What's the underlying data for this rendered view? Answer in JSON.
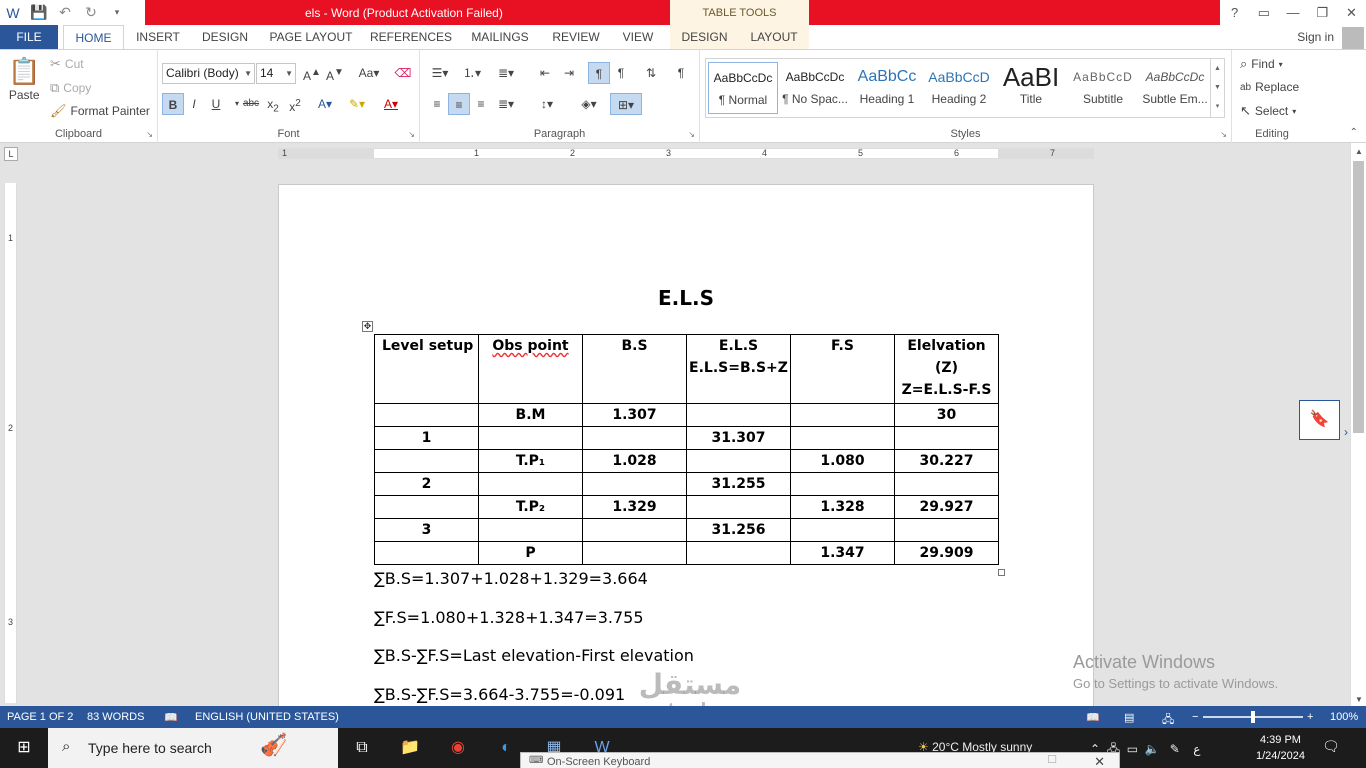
{
  "titlebar": {
    "doc_title": "els -  Word (Product Activation Failed)",
    "table_tools": "TABLE TOOLS",
    "help": "?",
    "restore": "▭",
    "minimize": "—",
    "maximize": "❐",
    "close": "✕"
  },
  "tabs": {
    "file": "FILE",
    "home": "HOME",
    "insert": "INSERT",
    "design": "DESIGN",
    "page_layout": "PAGE LAYOUT",
    "references": "REFERENCES",
    "mailings": "MAILINGS",
    "review": "REVIEW",
    "view": "VIEW",
    "table_design": "DESIGN",
    "table_layout": "LAYOUT",
    "sign_in": "Sign in"
  },
  "clipboard": {
    "paste": "Paste",
    "cut": "Cut",
    "copy": "Copy",
    "format_painter": "Format Painter",
    "label": "Clipboard"
  },
  "font": {
    "font_name": "Calibri (Body)",
    "font_size": "14",
    "label": "Font"
  },
  "paragraph": {
    "label": "Paragraph"
  },
  "styles": {
    "label": "Styles",
    "items": [
      {
        "preview": "AaBbCcDc",
        "name": "¶ Normal"
      },
      {
        "preview": "AaBbCcDc",
        "name": "¶ No Spac..."
      },
      {
        "preview": "AaBbCc",
        "name": "Heading 1"
      },
      {
        "preview": "AaBbCcD",
        "name": "Heading 2"
      },
      {
        "preview": "AaBI",
        "name": "Title"
      },
      {
        "preview": "AaBbCcD",
        "name": "Subtitle"
      },
      {
        "preview": "AaBbCcDc",
        "name": "Subtle Em..."
      }
    ]
  },
  "editing": {
    "find": "Find",
    "replace": "Replace",
    "select": "Select",
    "label": "Editing"
  },
  "ruler": {
    "h": [
      "1",
      "1",
      "2",
      "3",
      "4",
      "5",
      "6",
      "7"
    ],
    "v": [
      "1",
      "2",
      "3"
    ]
  },
  "document": {
    "heading": "E.L.S",
    "table": {
      "header": [
        "Level setup",
        "Obs point",
        "B.S",
        "E.L.S\nE.L.S=B.S+Z",
        "F.S",
        "Elelvation\n(Z)\nZ=E.L.S-F.S"
      ],
      "rows": [
        [
          "",
          "B.M",
          "1.307",
          "",
          "",
          "30"
        ],
        [
          "1",
          "",
          "",
          "31.307",
          "",
          ""
        ],
        [
          "",
          "T.P₁",
          "1.028",
          "",
          "1.080",
          "30.227"
        ],
        [
          "2",
          "",
          "",
          "31.255",
          "",
          ""
        ],
        [
          "",
          "T.P₂",
          "1.329",
          "",
          "1.328",
          "29.927"
        ],
        [
          "3",
          "",
          "",
          "31.256",
          "",
          ""
        ],
        [
          "",
          "P",
          "",
          "",
          "1.347",
          "29.909"
        ]
      ]
    },
    "equations": [
      "∑B.S=1.307+1.028+1.329=3.664",
      "∑F.S=1.080+1.328+1.347=3.755",
      "∑B.S-∑F.S=Last  elevation-First elevation",
      "∑B.S-∑F.S=3.664-3.755=-0.091"
    ]
  },
  "activation": {
    "line1": "Activate Windows",
    "line2": "Go to Settings to activate Windows."
  },
  "statusbar": {
    "page": "PAGE 1 OF 2",
    "words": "83 WORDS",
    "language": "ENGLISH (UNITED STATES)",
    "zoom": "100%",
    "zoom_level": 0.5
  },
  "taskbar": {
    "search_placeholder": "Type here to search",
    "weather": "20°C  Mostly sunny",
    "input_lang": "ع",
    "time": "4:39 PM",
    "date": "1/24/2024"
  },
  "osk": {
    "title": "On-Screen Keyboard"
  },
  "watermark": {
    "line1": "مستقل",
    "line2": "mostaql.com"
  },
  "colors": {
    "accent": "#2b579a",
    "title_bar_error": "#e81123",
    "context_tab": "#fdf4e3"
  }
}
